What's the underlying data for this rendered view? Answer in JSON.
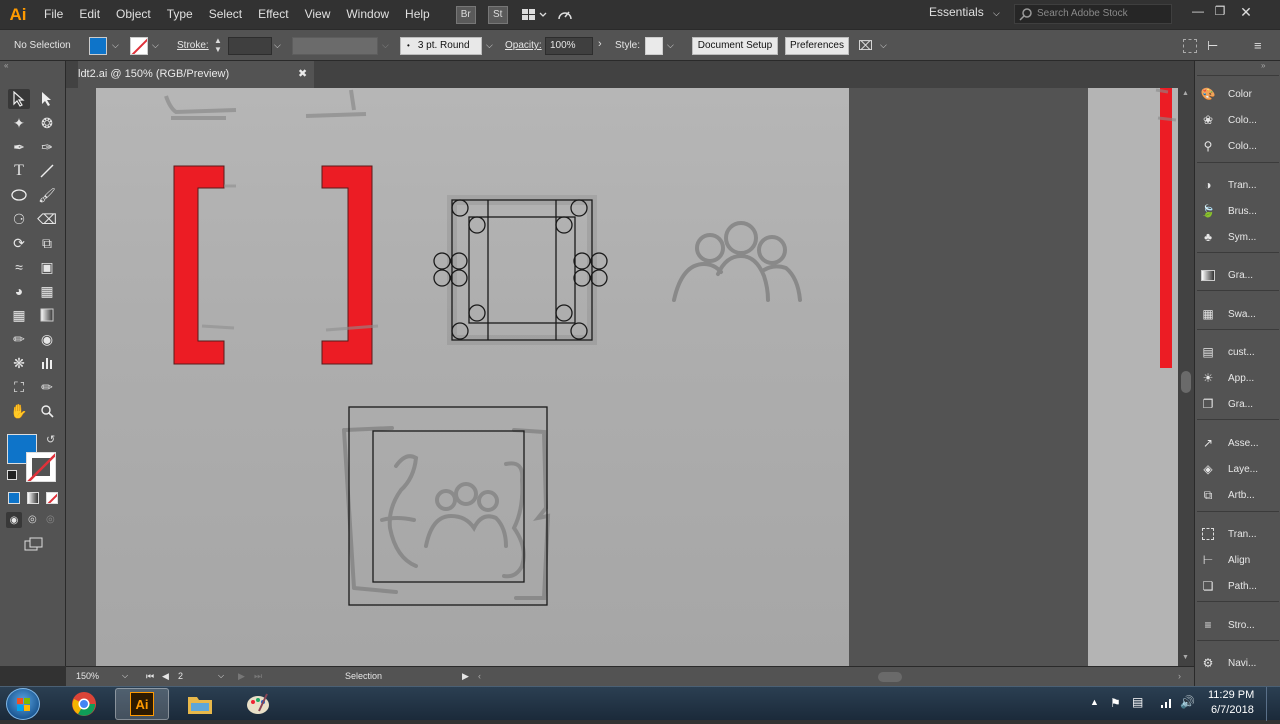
{
  "app": {
    "logo": "Ai"
  },
  "menu": [
    "File",
    "Edit",
    "Object",
    "Type",
    "Select",
    "Effect",
    "View",
    "Window",
    "Help"
  ],
  "bridge_badges": [
    "Br",
    "St"
  ],
  "workspace": {
    "label": "Essentials"
  },
  "stock_search": {
    "placeholder": "Search Adobe Stock"
  },
  "control_bar": {
    "selection_label": "No Selection",
    "stroke_label": "Stroke:",
    "brush_label": "3 pt. Round",
    "opacity_label": "Opacity:",
    "opacity_value": "100%",
    "style_label": "Style:",
    "document_setup": "Document Setup",
    "preferences": "Preferences",
    "fill_color": "#0e74c9",
    "stroke_none_color": "#e0313a"
  },
  "document_tab": {
    "title": "ldt2.ai @ 150% (RGB/Preview)",
    "close": "✖"
  },
  "toolbar": {
    "fill_color": "#0e74c9",
    "stroke_none_color": "#e0313a"
  },
  "status_bar": {
    "zoom": "150%",
    "artboard_number": "2",
    "tool_name": "Selection"
  },
  "panels": [
    {
      "label": "Color",
      "icon": "color-icon"
    },
    {
      "label": "Colo...",
      "icon": "color-guide-icon"
    },
    {
      "label": "Colo...",
      "icon": "color-themes-icon"
    },
    {
      "label": "Tran...",
      "icon": "transparency-icon"
    },
    {
      "label": "Brus...",
      "icon": "brushes-icon"
    },
    {
      "label": "Sym...",
      "icon": "symbols-icon"
    },
    {
      "label": "Gra...",
      "icon": "gradient-icon"
    },
    {
      "label": "Swa...",
      "icon": "swatches-icon"
    },
    {
      "label": "cust...",
      "icon": "libraries-icon"
    },
    {
      "label": "App...",
      "icon": "appearance-icon"
    },
    {
      "label": "Gra...",
      "icon": "graphic-styles-icon"
    },
    {
      "label": "Asse...",
      "icon": "asset-export-icon"
    },
    {
      "label": "Laye...",
      "icon": "layers-icon"
    },
    {
      "label": "Artb...",
      "icon": "artboards-icon"
    },
    {
      "label": "Tran...",
      "icon": "transform-icon"
    },
    {
      "label": "Align",
      "icon": "align-icon"
    },
    {
      "label": "Path...",
      "icon": "pathfinder-icon"
    },
    {
      "label": "Stro...",
      "icon": "stroke-icon"
    },
    {
      "label": "Navi...",
      "icon": "navigator-icon"
    }
  ],
  "taskbar": {
    "time": "11:29 PM",
    "date": "6/7/2018"
  },
  "colors": {
    "bracket_red": "#ec1c24",
    "ui_dark": "#323232",
    "ui_mid": "#535353"
  }
}
